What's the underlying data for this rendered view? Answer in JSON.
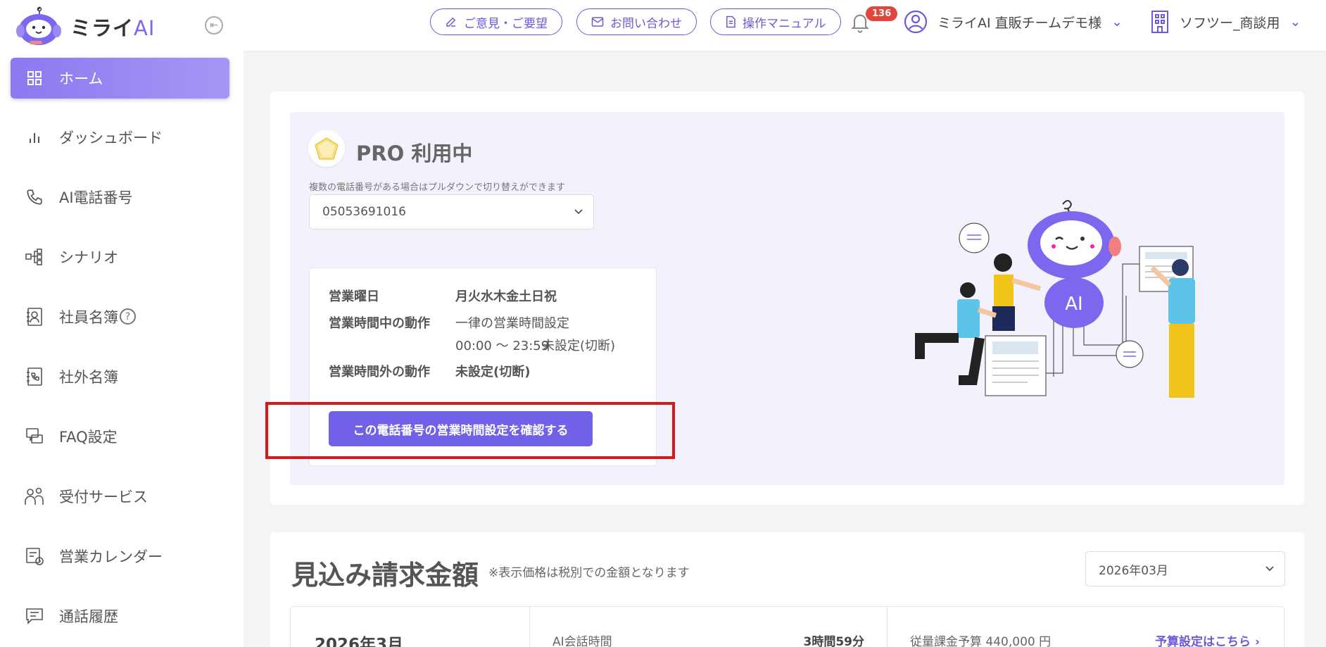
{
  "app": {
    "logo_text": "ミライ",
    "logo_ai": "AI"
  },
  "sidebar": {
    "items": [
      {
        "label": "ホーム",
        "icon": "grid-icon"
      },
      {
        "label": "ダッシュボード",
        "icon": "bar-chart-icon"
      },
      {
        "label": "AI電話番号",
        "icon": "phone-icon"
      },
      {
        "label": "シナリオ",
        "icon": "flow-icon"
      },
      {
        "label": "社員名簿",
        "icon": "contact-book-icon"
      },
      {
        "label": "社外名簿",
        "icon": "phone-book-icon"
      },
      {
        "label": "FAQ設定",
        "icon": "faq-icon"
      },
      {
        "label": "受付サービス",
        "icon": "people-icon"
      },
      {
        "label": "営業カレンダー",
        "icon": "calendar-icon"
      },
      {
        "label": "通話履歴",
        "icon": "chat-log-icon"
      }
    ],
    "help_mark": "?"
  },
  "header": {
    "feedback_label": "ご意見・ご要望",
    "contact_label": "お問い合わせ",
    "manual_label": "操作マニュアル",
    "notification_count": "136",
    "user_name": "ミライAI 直販チームデモ様",
    "org_name": "ソフツー_商談用"
  },
  "plan": {
    "title": "PRO 利用中",
    "select_hint": "複数の電話番号がある場合はプルダウンで切り替えができます",
    "selected_phone": "05053691016"
  },
  "hours": {
    "days_label": "営業曜日",
    "days_value": "月火水木金土日祝",
    "during_label": "営業時間中の動作",
    "during_value": "一律の営業時間設定",
    "during_time": "00:00 〜 23:59",
    "during_action": "未設定(切断)",
    "outside_label": "営業時間外の動作",
    "outside_value": "未設定(切断)",
    "confirm_button": "この電話番号の営業時間設定を確認する"
  },
  "illustration": {
    "robot_label": "AI"
  },
  "billing": {
    "title": "見込み請求金額",
    "note": "※表示価格は税別での金額となります",
    "selected_month": "2026年03月",
    "summary_month": "2026年3月",
    "ai_time_label": "AI会話時間",
    "ai_time_value": "3時間59分",
    "budget_label": "従量課金予算 440,000 円",
    "budget_link": "予算設定はこちら ›"
  },
  "colors": {
    "accent": "#7160e8",
    "badge": "#e0463d",
    "highlight": "#d21b1b",
    "panel_bg": "#f3f2fc"
  }
}
